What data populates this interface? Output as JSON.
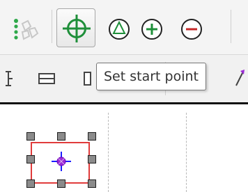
{
  "tooltip": {
    "text": "Set start point"
  },
  "toolbar": {
    "buttons": [
      {
        "name": "pose-steps-icon"
      },
      {
        "name": "set-start-point-icon",
        "selected": true
      },
      {
        "name": "triangle-circle-icon"
      },
      {
        "name": "plus-circle-icon"
      },
      {
        "name": "minus-circle-icon"
      }
    ],
    "row2": [
      {
        "name": "align-icon"
      },
      {
        "name": "rectangle-icon"
      },
      {
        "name": "bracket-icon"
      },
      {
        "name": "arrow-icon"
      }
    ]
  },
  "colors": {
    "accent_green": "#1f8f3a",
    "minus_red": "#c62828",
    "selection_red": "#e03b3b",
    "marker_purple": "#9b2bd6",
    "marker_blue": "#1b1bff"
  }
}
